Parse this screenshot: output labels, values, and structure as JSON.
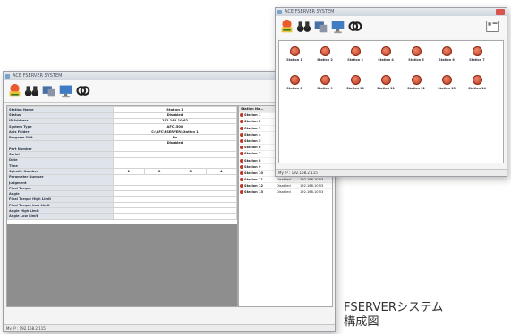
{
  "back_window": {
    "title": "ACE FSERVER SYSTEM",
    "toolbar_icons": [
      "connect-icon",
      "binoculars-icon",
      "station-icon",
      "monitor-icon",
      "search-icon"
    ],
    "properties": [
      {
        "label": "Station Name",
        "value": "Station 1"
      },
      {
        "label": "Status",
        "value": "Disabled"
      },
      {
        "label": "IP Address",
        "value": "192.168.10.62"
      },
      {
        "label": "System Type",
        "value": "AFC1500"
      },
      {
        "label": "Axis Folder",
        "value": "C:\\AFC\\FSERVER\\Station 1"
      },
      {
        "label": "Program Skit",
        "value": "No"
      },
      {
        "label": "",
        "value": "Disabled"
      },
      {
        "label": "Part Number",
        "value": ""
      },
      {
        "label": "Serial",
        "value": ""
      },
      {
        "label": "Date",
        "value": ""
      },
      {
        "label": "Time",
        "value": ""
      },
      {
        "label": "Spindle Number",
        "cells": [
          "1",
          "2",
          "3",
          "4"
        ]
      },
      {
        "label": "Parameter Number",
        "value": ""
      },
      {
        "label": "Judgment",
        "value": ""
      },
      {
        "label": "Final Torque",
        "value": ""
      },
      {
        "label": "Angle",
        "value": ""
      },
      {
        "label": "Final Torque High Limit",
        "value": ""
      },
      {
        "label": "Final Torque Low Limit",
        "value": ""
      },
      {
        "label": "Angle High Limit",
        "value": ""
      },
      {
        "label": "Angle Low Limit",
        "value": ""
      }
    ],
    "station_list": {
      "header": "Station Na...",
      "rows": [
        {
          "name": "Station 1",
          "status": "",
          "ip": ""
        },
        {
          "name": "Station 2",
          "status": "",
          "ip": ""
        },
        {
          "name": "Station 3",
          "status": "",
          "ip": ""
        },
        {
          "name": "Station 4",
          "status": "",
          "ip": ""
        },
        {
          "name": "Station 5",
          "status": "",
          "ip": ""
        },
        {
          "name": "Station 6",
          "status": "",
          "ip": ""
        },
        {
          "name": "Station 7",
          "status": "",
          "ip": ""
        },
        {
          "name": "Station 8",
          "status": "",
          "ip": ""
        },
        {
          "name": "Station 9",
          "status": "",
          "ip": ""
        },
        {
          "name": "Station 10",
          "status": "Disabled",
          "ip": "192.168.10.53"
        },
        {
          "name": "Station 11",
          "status": "Disabled",
          "ip": "192.168.10.53"
        },
        {
          "name": "Station 12",
          "status": "Disabled",
          "ip": "192.168.10.53"
        },
        {
          "name": "Station 13",
          "status": "Disabled",
          "ip": "192.168.10.53"
        }
      ]
    },
    "statusbar": "My IP : 192.168.2.115"
  },
  "front_window": {
    "title": "ACE FSERVER SYSTEM",
    "toolbar_icons": [
      "connect-icon",
      "binoculars-icon",
      "station-icon",
      "monitor-icon",
      "search-icon"
    ],
    "stations": [
      "Station 1",
      "Station 2",
      "Station 3",
      "Station 4",
      "Station 5",
      "Station 6",
      "Station 7",
      "Station 8",
      "Station 9",
      "Station 10",
      "Station 11",
      "Station 12",
      "Station 13",
      "Station 14"
    ],
    "statusbar": "My IP : 192.168.2.115"
  },
  "caption": {
    "line1": "FSERVERシステム",
    "line2": "構成図"
  },
  "colors": {
    "station_icon": "#c0392b",
    "label_bg": "#dfe3ea",
    "grey_area": "#8e8e8e"
  }
}
